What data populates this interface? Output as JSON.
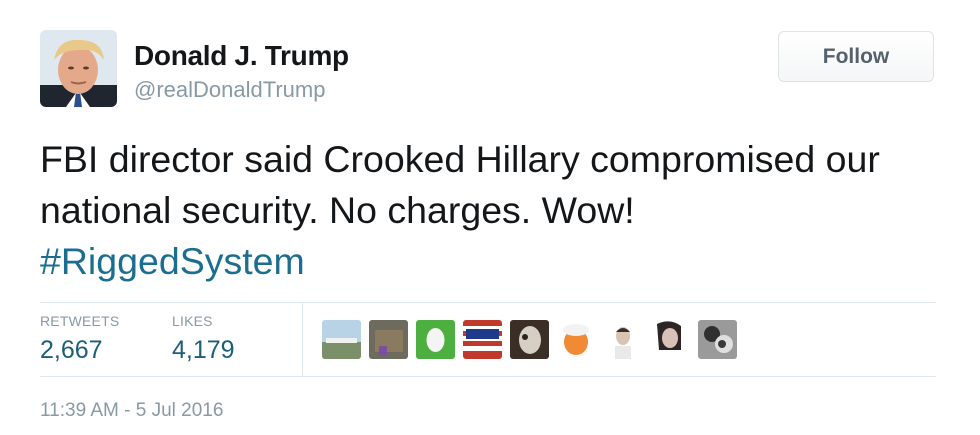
{
  "user": {
    "name": "Donald J. Trump",
    "handle": "@realDonaldTrump"
  },
  "follow_label": "Follow",
  "tweet": {
    "text": "FBI director said Crooked Hillary compromised our national security. No charges. Wow!",
    "hashtag": "#RiggedSystem"
  },
  "stats": {
    "retweets_label": "RETWEETS",
    "retweets_value": "2,667",
    "likes_label": "LIKES",
    "likes_value": "4,179"
  },
  "timestamp": "11:39 AM - 5 Jul 2016",
  "colors": {
    "hashtag": "#1b6e8f",
    "stat_value": "#1b5e7a",
    "muted": "#8899a6"
  }
}
